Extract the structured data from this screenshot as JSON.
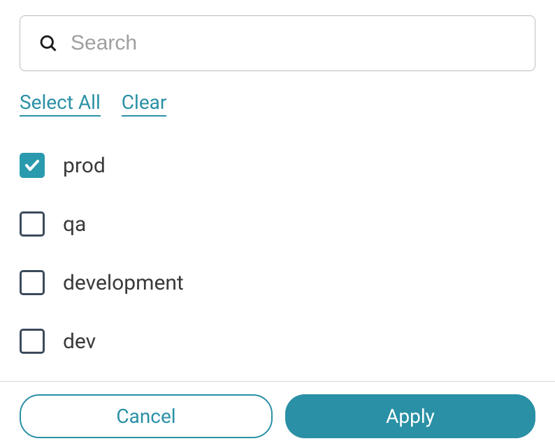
{
  "search": {
    "placeholder": "Search",
    "value": ""
  },
  "links": {
    "select_all": "Select All",
    "clear": "Clear"
  },
  "options": [
    {
      "label": "prod",
      "checked": true
    },
    {
      "label": "qa",
      "checked": false
    },
    {
      "label": "development",
      "checked": false
    },
    {
      "label": "dev",
      "checked": false
    }
  ],
  "footer": {
    "cancel": "Cancel",
    "apply": "Apply"
  }
}
